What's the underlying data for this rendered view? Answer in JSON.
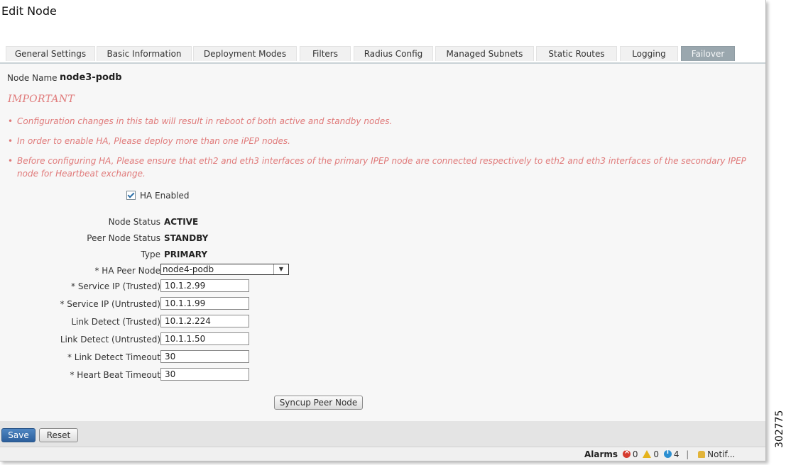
{
  "window": {
    "title": "Edit Node"
  },
  "tabs": [
    {
      "label": "General Settings"
    },
    {
      "label": "Basic Information"
    },
    {
      "label": "Deployment Modes"
    },
    {
      "label": "Filters"
    },
    {
      "label": "Radius Config"
    },
    {
      "label": "Managed Subnets"
    },
    {
      "label": "Static Routes"
    },
    {
      "label": "Logging"
    },
    {
      "label": "Failover",
      "active": true
    }
  ],
  "node": {
    "name_label": "Node Name",
    "name_value": "node3-podb"
  },
  "notice": {
    "heading": "IMPORTANT",
    "items": [
      "Configuration changes in this tab will result in reboot of both active and standby nodes.",
      "In order to enable HA, Please deploy more than one iPEP nodes.",
      "Before configuring HA, Please ensure that eth2 and eth3 interfaces of the primary IPEP node are connected respectively to eth2 and eth3 interfaces of the secondary IPEP node for Heartbeat exchange."
    ]
  },
  "ha_enabled": {
    "label": "HA Enabled",
    "checked": true
  },
  "fields": {
    "node_status": {
      "label": "Node Status",
      "value": "ACTIVE"
    },
    "peer_node_status": {
      "label": "Peer Node Status",
      "value": "STANDBY"
    },
    "type": {
      "label": "Type",
      "value": "PRIMARY"
    },
    "ha_peer_node": {
      "label": "* HA Peer Node",
      "value": "node4-podb"
    },
    "service_ip_trusted": {
      "label": "* Service IP (Trusted)",
      "value": "10.1.2.99"
    },
    "service_ip_untrusted": {
      "label": "* Service IP (Untrusted)",
      "value": "10.1.1.99"
    },
    "link_detect_trusted": {
      "label": "Link Detect (Trusted)",
      "value": "10.1.2.224"
    },
    "link_detect_untrusted": {
      "label": "Link Detect (Untrusted)",
      "value": "10.1.1.50"
    },
    "link_detect_timeout": {
      "label": "* Link Detect Timeout",
      "value": "30"
    },
    "heart_beat_timeout": {
      "label": "* Heart Beat Timeout",
      "value": "30"
    }
  },
  "buttons": {
    "syncup": "Syncup Peer Node",
    "save": "Save",
    "reset": "Reset"
  },
  "statusbar": {
    "alarms_label": "Alarms",
    "errors": "0",
    "warnings": "0",
    "info": "4",
    "notifications_label": "Notif..."
  },
  "figure_number": "302775",
  "colors": {
    "accent": "#2c5f9c",
    "warning_text": "#e07a7a",
    "active_tab": "#9aa7ae"
  }
}
